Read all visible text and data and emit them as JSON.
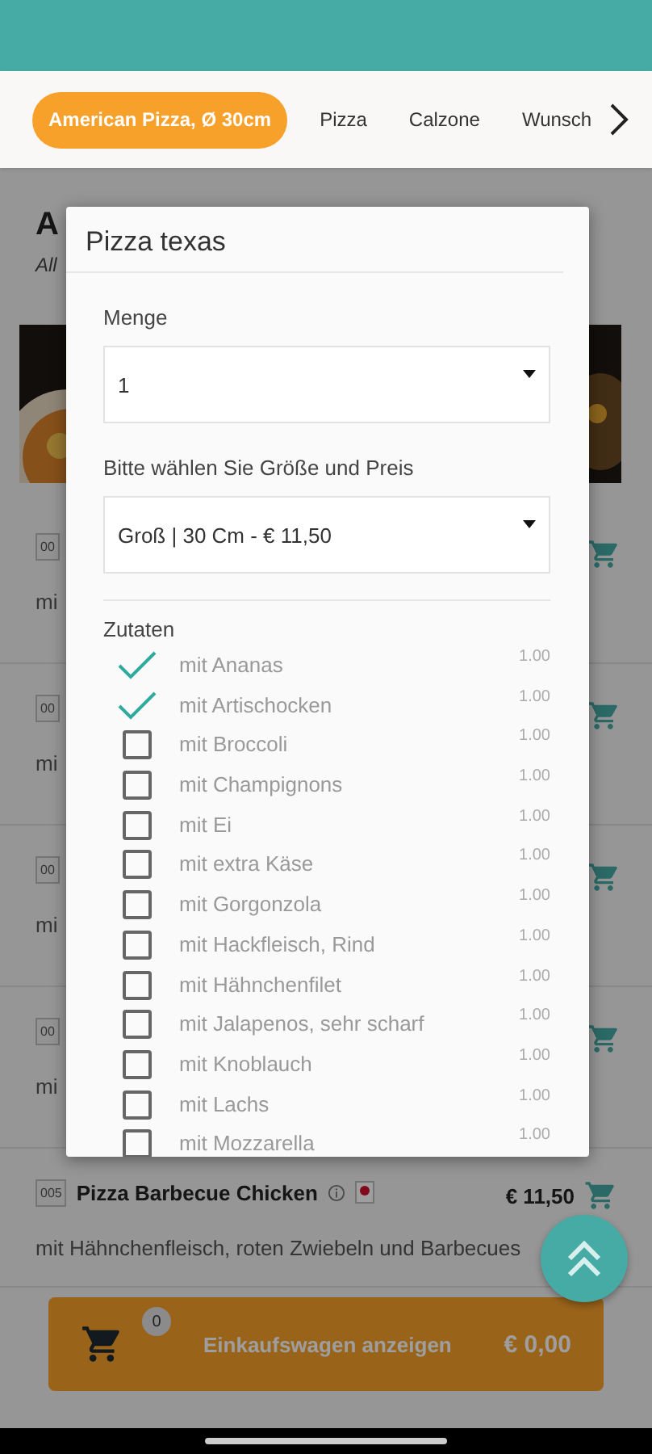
{
  "categories": [
    {
      "label": "American Pizza, Ø 30cm",
      "selected": true
    },
    {
      "label": "Pizza",
      "selected": false
    },
    {
      "label": "Calzone",
      "selected": false
    },
    {
      "label": "Wunsch",
      "selected": false
    }
  ],
  "section": {
    "title": "A",
    "subtitle": "All"
  },
  "products": [
    {
      "kind": "covered",
      "code": "00",
      "description": "mi"
    },
    {
      "kind": "covered",
      "code": "00",
      "description": "mi"
    },
    {
      "kind": "covered",
      "code": "00",
      "description": "mi"
    },
    {
      "kind": "covered",
      "code": "00",
      "description": "mi"
    },
    {
      "kind": "full",
      "code": "005",
      "name": "Pizza Barbecue Chicken",
      "price": "€ 11,50",
      "description": "mit Hähnchenfleisch, roten Zwiebeln und Barbecues"
    }
  ],
  "cart": {
    "count": "0",
    "label": "Einkaufswagen anzeigen",
    "total": "€ 0,00"
  },
  "dialog": {
    "title": "Pizza texas",
    "fields": [
      {
        "label": "Menge",
        "value": "1"
      },
      {
        "label": "Bitte wählen Sie Größe und Preis",
        "value": "Groß | 30 Cm - € 11,50"
      }
    ],
    "ingredients_label": "Zutaten",
    "ingredients": [
      {
        "name": "mit Ananas",
        "price": "1.00",
        "checked": true
      },
      {
        "name": "mit Artischocken",
        "price": "1.00",
        "checked": true
      },
      {
        "name": "mit Broccoli",
        "price": "1.00",
        "checked": false
      },
      {
        "name": "mit Champignons",
        "price": "1.00",
        "checked": false
      },
      {
        "name": "mit Ei",
        "price": "1.00",
        "checked": false
      },
      {
        "name": "mit extra Käse",
        "price": "1.00",
        "checked": false
      },
      {
        "name": "mit Gorgonzola",
        "price": "1.00",
        "checked": false
      },
      {
        "name": "mit Hackfleisch, Rind",
        "price": "1.00",
        "checked": false
      },
      {
        "name": "mit Hähnchenfilet",
        "price": "1.00",
        "checked": false
      },
      {
        "name": "mit Jalapenos, sehr scharf",
        "price": "1.00",
        "checked": false
      },
      {
        "name": "mit Knoblauch",
        "price": "1.00",
        "checked": false
      },
      {
        "name": "mit Lachs",
        "price": "1.00",
        "checked": false
      },
      {
        "name": "mit Mozzarella",
        "price": "1.00",
        "checked": false
      }
    ]
  }
}
